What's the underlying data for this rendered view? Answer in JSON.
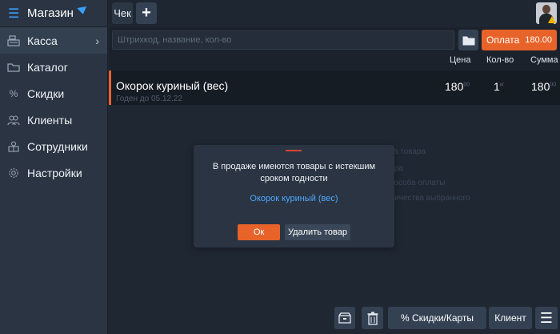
{
  "sidebar": {
    "title": "Магазин",
    "items": [
      {
        "label": "Касса",
        "icon": "register-icon"
      },
      {
        "label": "Каталог",
        "icon": "folder-icon"
      },
      {
        "label": "Скидки",
        "icon": "percent-icon"
      },
      {
        "label": "Клиенты",
        "icon": "clients-icon"
      },
      {
        "label": "Сотрудники",
        "icon": "employees-icon"
      },
      {
        "label": "Настройки",
        "icon": "gear-icon"
      }
    ]
  },
  "topbar": {
    "tab_label": "Чек",
    "add_label": "+"
  },
  "search": {
    "placeholder": "Штрихкод, название, кол-во"
  },
  "payment": {
    "label": "Оплата",
    "amount": "180.00"
  },
  "columns": {
    "price": "Цена",
    "qty": "Кол-во",
    "sum": "Сумма"
  },
  "items": [
    {
      "name": "Окорок куриный (вес)",
      "expiry": "Годен до 05.12.22",
      "price": "180",
      "price_frac": "00",
      "qty": "1",
      "qty_unit": "кг",
      "sum": "180",
      "sum_frac": "00"
    }
  ],
  "hints": [
    "тва товара",
    "вара",
    "способа оплаты",
    "оличества выбранного"
  ],
  "modal": {
    "message": "В продаже имеются товары с истекшим сроком годности",
    "product": "Окорок куриный (вес)",
    "ok_label": "Ок",
    "delete_label": "Удалить товар"
  },
  "bottom": {
    "discounts_label": "% Скидки/Карты",
    "client_label": "Клиент"
  },
  "colors": {
    "accent": "#e8632a",
    "link": "#4fa8ff",
    "brand": "#3aa0ff"
  }
}
